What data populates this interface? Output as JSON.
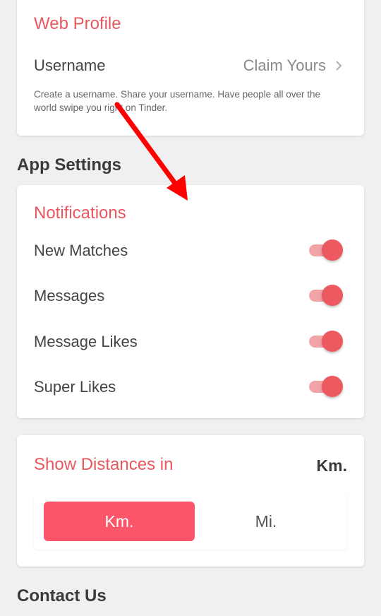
{
  "web_profile": {
    "title": "Web Profile",
    "username_label": "Username",
    "claim_label": "Claim Yours",
    "description": "Create a username. Share your username. Have people all over the world swipe you right on Tinder."
  },
  "app_settings": {
    "heading": "App Settings",
    "notifications": {
      "title": "Notifications",
      "items": [
        {
          "label": "New Matches",
          "enabled": true
        },
        {
          "label": "Messages",
          "enabled": true
        },
        {
          "label": "Message Likes",
          "enabled": true
        },
        {
          "label": "Super Likes",
          "enabled": true
        }
      ]
    },
    "distance": {
      "title": "Show Distances in",
      "current_unit": "Km.",
      "options": [
        "Km.",
        "Mi."
      ],
      "selected": "Km."
    }
  },
  "contact": {
    "heading": "Contact Us"
  },
  "colors": {
    "accent": "#e8585e",
    "toggle_on": "#ec5a60",
    "selected_segment": "#fb5569",
    "annotation_arrow": "#ff0000"
  }
}
